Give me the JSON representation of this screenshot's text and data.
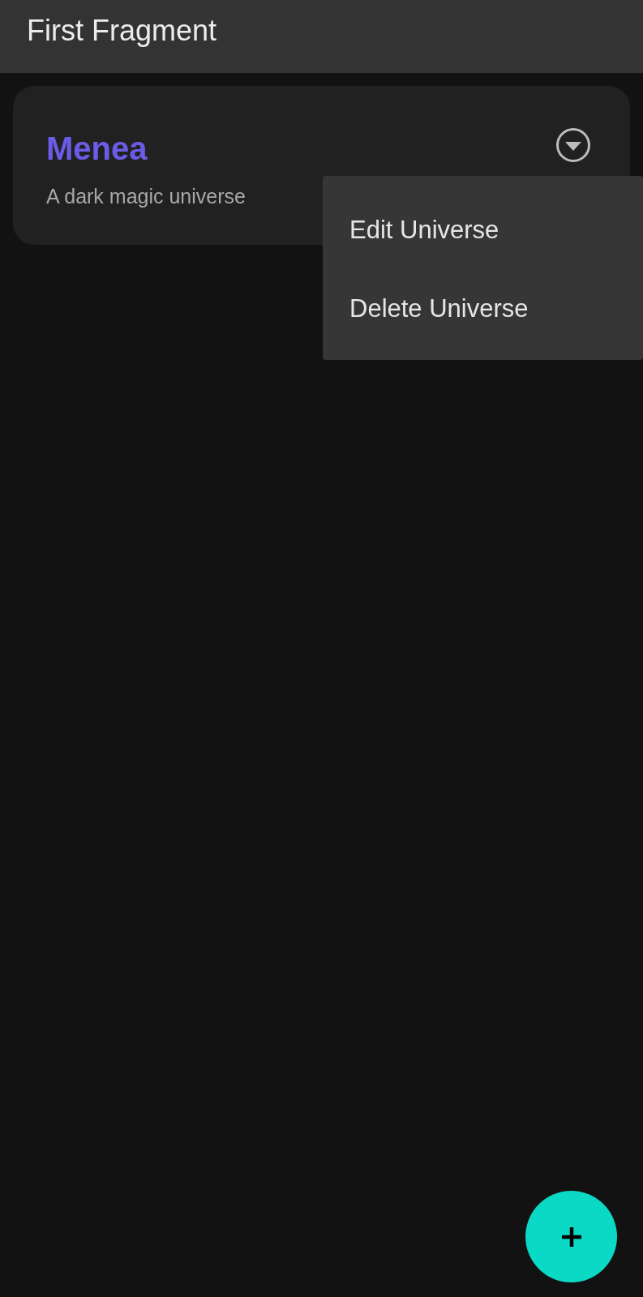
{
  "app_bar": {
    "title": "First Fragment"
  },
  "universes": [
    {
      "name": "Menea",
      "description": "A dark magic universe"
    }
  ],
  "menu": {
    "open": true,
    "items": [
      {
        "label": "Edit Universe"
      },
      {
        "label": "Delete Universe"
      }
    ]
  }
}
